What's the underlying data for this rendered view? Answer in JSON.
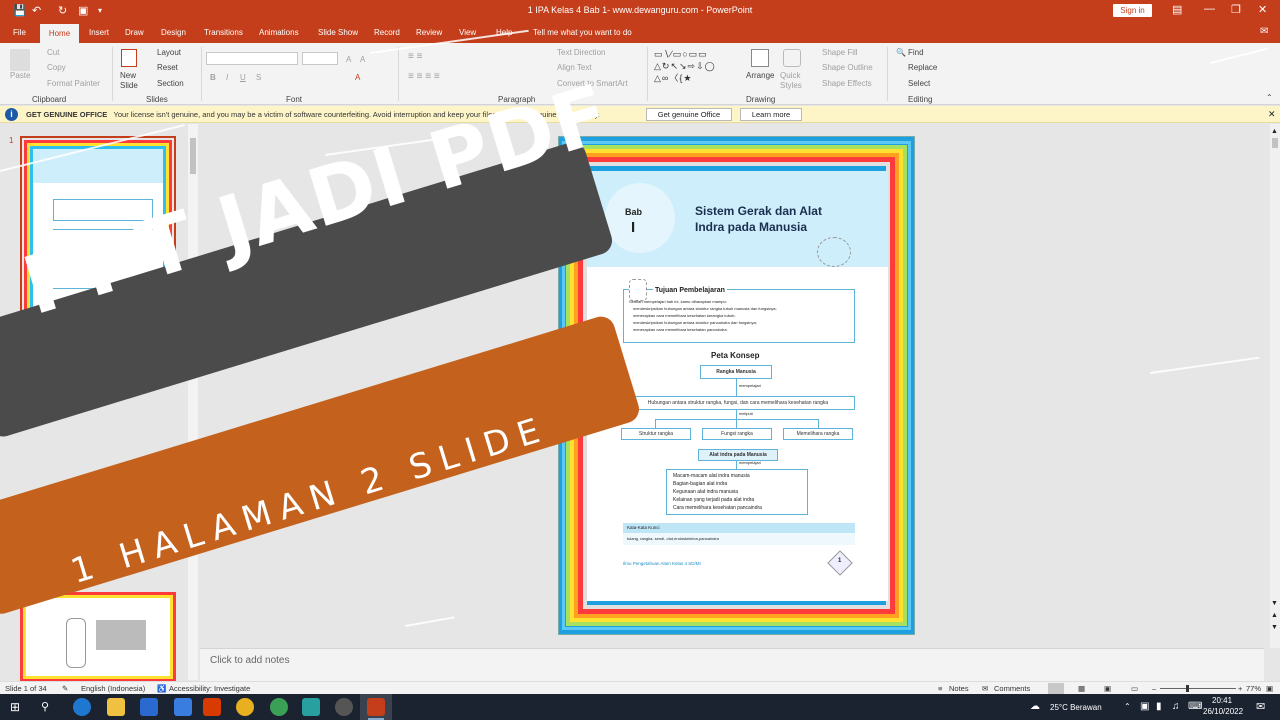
{
  "window": {
    "doc_title": "1 IPA Kelas 4 Bab 1- www.dewanguru.com  -  PowerPoint",
    "sign_in": "Sign in"
  },
  "tabs": [
    "File",
    "Home",
    "Insert",
    "Draw",
    "Design",
    "Transitions",
    "Animations",
    "Slide Show",
    "Record",
    "Review",
    "View",
    "Help"
  ],
  "active_tab": "Home",
  "tell_me": "Tell me what you want to do",
  "ribbon": {
    "clipboard": {
      "paste": "Paste",
      "cut": "Cut",
      "copy": "Copy",
      "format_painter": "Format Painter",
      "label": "Clipboard"
    },
    "slides": {
      "new_slide": "New Slide",
      "layout": "Layout",
      "reset": "Reset",
      "section": "Section",
      "label": "Slides"
    },
    "font": {
      "label": "Font"
    },
    "paragraph": {
      "text_direction": "Text Direction",
      "align_text": "Align Text",
      "convert_smartart": "Convert to SmartArt",
      "label": "Paragraph"
    },
    "drawing": {
      "arrange": "Arrange",
      "quick_styles": "Quick Styles",
      "shape_fill": "Shape Fill",
      "shape_outline": "Shape Outline",
      "shape_effects": "Shape Effects",
      "label": "Drawing"
    },
    "editing": {
      "find": "Find",
      "replace": "Replace",
      "select": "Select",
      "label": "Editing"
    }
  },
  "infobar": {
    "title": "GET GENUINE OFFICE",
    "message": "Your license isn't genuine, and you may be a victim of software counterfeiting. Avoid interruption and keep your files safe with genuine Office today.",
    "btn_genuine": "Get genuine Office",
    "btn_learn": "Learn more"
  },
  "thumbs": {
    "number": "1"
  },
  "slide": {
    "bab": "Bab",
    "bab_num": "I",
    "title1": "Sistem Gerak dan Alat",
    "title2": "Indra pada Manusia",
    "tujuan": "Tujuan Pembelajaran",
    "tujuan_intro": "Setelah mempelajari bab ini, kamu diharapkan mampu:",
    "tujuan_items": [
      "mendeskripsikan hubungan antara struktur rangka tubuh manusia dan fungsinya;",
      "menerapkan cara memelihara kesehatan kerangka tubuh;",
      "mendeskripsikan hubungan antara struktur pancaindra dan fungsinya;",
      "menerapkan cara memelihara kesehatan pancaindra."
    ],
    "peta": "Peta Konsep",
    "rangka": "Rangka Manusia",
    "mempelajari": "mempelajari",
    "hubungan": "Hubungan antara struktur rangka, fungsi, dan cara memelihara kesehatan rangka",
    "meliputi": "meliputi",
    "struktur": "Struktur rangka",
    "fungsi": "Fungsi rangka",
    "memelihara": "Memelihara rangka",
    "alat_indra": "Alat indra pada Manusia",
    "mempelajari2": "mempelajari",
    "indra_items": [
      "Macam-macam alat indra manusia",
      "Bagian-bagian alat indra",
      "Kegunaan alat indra manusia",
      "Kelainan yang terjadi pada alat indra",
      "Cara memelihara kesehatan pancaindra"
    ],
    "kata_kunci": "Kata-Kata Kunci",
    "kata_list": "tulang, rangka, sendi, otot,endoskeleton,pancaindra",
    "footer": "Ilmu Pengetahuan Alam Kelas 4 SD/MI",
    "page_num": "1"
  },
  "notes": "Click to add notes",
  "status": {
    "slide_of": "Slide 1 of 34",
    "language": "English (Indonesia)",
    "accessibility": "Accessibility: Investigate",
    "notes_btn": "Notes",
    "comments_btn": "Comments",
    "zoom": "77%"
  },
  "taskbar": {
    "weather": "25°C  Berawan",
    "time": "20:41",
    "date": "26/10/2022"
  },
  "overlay": {
    "headline": "PPT JADI PDF",
    "subline": "1 HALAMAN 2 SLIDE"
  },
  "colors": {
    "accent": "#c43e1c",
    "banner_dark": "#4b4b4b",
    "banner_orange": "#c4611c"
  }
}
